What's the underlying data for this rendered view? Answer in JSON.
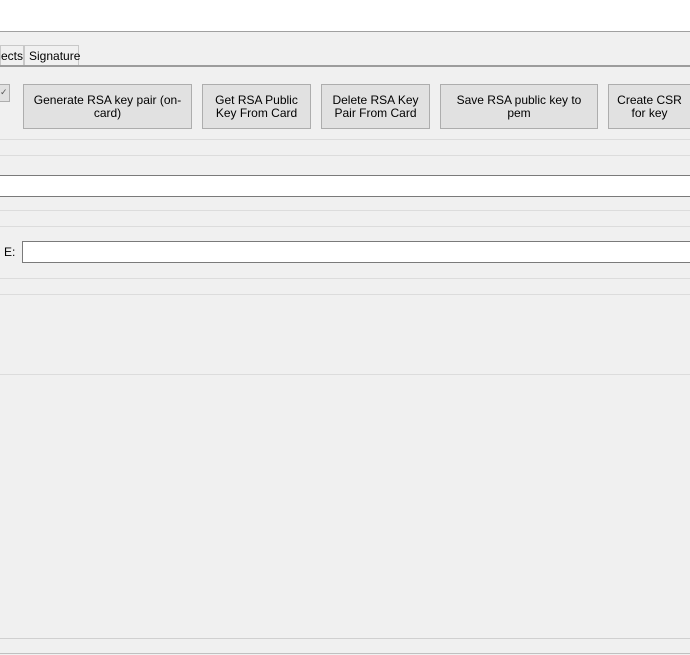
{
  "tabs": [
    {
      "label": "ects"
    },
    {
      "label": "Signature"
    }
  ],
  "buttons": {
    "generate": "Generate RSA key pair (on-card)",
    "get_public": "Get RSA Public Key From Card",
    "delete_pair": "Delete RSA Key Pair From Card",
    "save_pem": "Save RSA public key to pem",
    "create_csr": "Create CSR for key"
  },
  "fields": {
    "e_label": "E:",
    "e_value": "",
    "top_value": ""
  }
}
